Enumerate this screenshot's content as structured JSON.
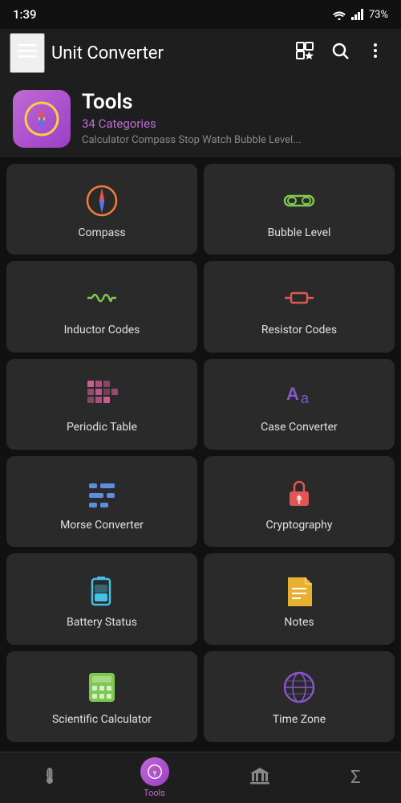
{
  "statusBar": {
    "time": "1:39",
    "battery": "73%"
  },
  "topBar": {
    "title": "Unit Converter",
    "menuIcon": "menu",
    "favoritesIcon": "grid-star",
    "searchIcon": "search",
    "moreIcon": "more-vertical"
  },
  "headerCard": {
    "title": "Tools",
    "categoryCount": "34 Categories",
    "subtitle": "Calculator Compass Stop Watch Bubble Level..."
  },
  "gridItems": [
    {
      "id": "compass",
      "label": "Compass",
      "iconColor": "#f47c3c"
    },
    {
      "id": "bubble-level",
      "label": "Bubble Level",
      "iconColor": "#7ec850"
    },
    {
      "id": "inductor-codes",
      "label": "Inductor Codes",
      "iconColor": "#7ec850"
    },
    {
      "id": "resistor-codes",
      "label": "Resistor Codes",
      "iconColor": "#e05555"
    },
    {
      "id": "periodic-table",
      "label": "Periodic Table",
      "iconColor": "#e060a0"
    },
    {
      "id": "case-converter",
      "label": "Case Converter",
      "iconColor": "#8855cc"
    },
    {
      "id": "morse-converter",
      "label": "Morse Converter",
      "iconColor": "#5b8de0"
    },
    {
      "id": "cryptography",
      "label": "Cryptography",
      "iconColor": "#e05555"
    },
    {
      "id": "battery-status",
      "label": "Battery Status",
      "iconColor": "#45c0e8"
    },
    {
      "id": "notes",
      "label": "Notes",
      "iconColor": "#e8b030"
    },
    {
      "id": "scientific-calculator",
      "label": "Scientific Calculator",
      "iconColor": "#7ec850"
    },
    {
      "id": "time-zone",
      "label": "Time Zone",
      "iconColor": "#8855cc"
    }
  ],
  "bottomNav": {
    "items": [
      {
        "id": "thermometer",
        "label": "",
        "icon": "thermometer",
        "active": false
      },
      {
        "id": "tools",
        "label": "Tools",
        "icon": "compass",
        "active": true
      },
      {
        "id": "bank",
        "label": "",
        "icon": "bank",
        "active": false
      },
      {
        "id": "sigma",
        "label": "",
        "icon": "sigma",
        "active": false
      }
    ]
  }
}
